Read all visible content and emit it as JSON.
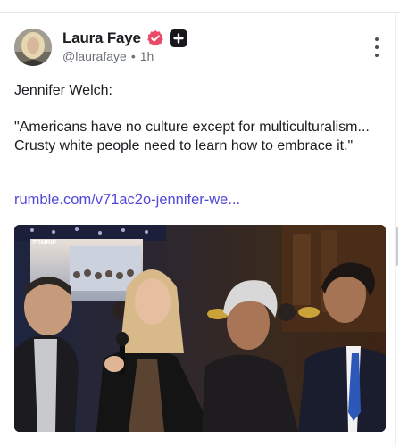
{
  "post": {
    "author": {
      "display_name": "Laura Faye",
      "handle": "@laurafaye",
      "verified_icon": "verified-badge-icon",
      "plus_icon": "plus-badge-icon"
    },
    "meta": {
      "separator": "•",
      "time": "1h"
    },
    "text": {
      "line1": "Jennifer Welch:",
      "line2": "\"Americans have no culture except for multiculturalism... Crusty white people need to learn how to embrace it.\""
    },
    "link": "rumble.com/v71ac2o-jennifer-we...",
    "media": {
      "screen_logo": "ZOMBIE"
    }
  },
  "colors": {
    "accent": "#5448d9",
    "verified": "#e94a68",
    "text": "#1b1d21",
    "muted": "#6b7078"
  },
  "icons": {
    "more": "more-vertical-icon"
  }
}
